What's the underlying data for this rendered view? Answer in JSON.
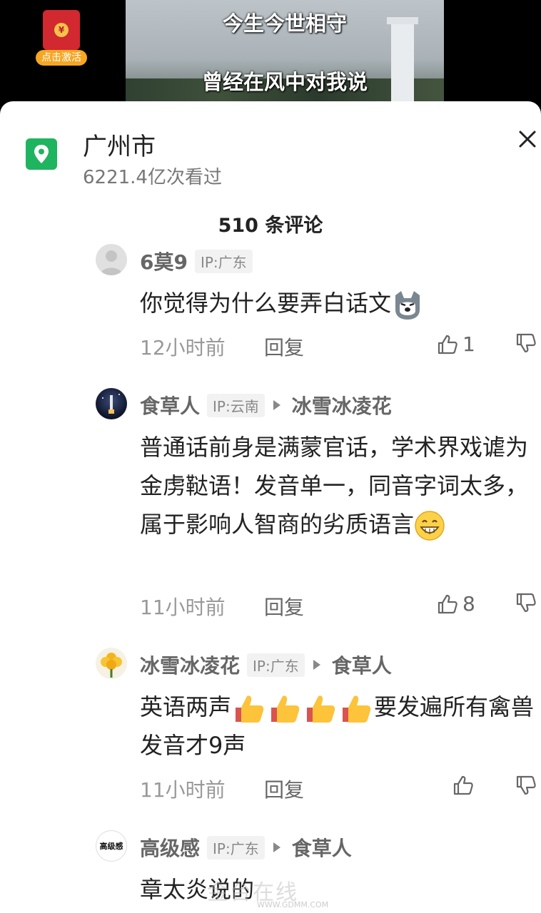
{
  "video": {
    "line1": "今生今世相守",
    "line2": "曾经在风中对我说",
    "red_packet_label": "点击激活"
  },
  "location": {
    "title": "广州市",
    "views": "6221.4亿次看过"
  },
  "comment_count": "510 条评论",
  "comments": [
    {
      "author": "6莫9",
      "ip": "IP:广东",
      "reply_to": "",
      "text": "你觉得为什么要弄白话文",
      "time": "12小时前",
      "reply_label": "回复",
      "likes": "1"
    },
    {
      "author": "食草人",
      "ip": "IP:云南",
      "reply_to": "冰雪冰凌花",
      "text": "普通话前身是满蒙官话，学术界戏谑为金虏鞑语！发音单一，同音字词太多，属于影响人智商的劣质语言",
      "time": "11小时前",
      "reply_label": "回复",
      "likes": "8"
    },
    {
      "author": "冰雪冰凌花",
      "ip": "IP:广东",
      "reply_to": "食草人",
      "text_a": "英语两声",
      "text_b": "要发遍所有禽兽发音才9声",
      "time": "11小时前",
      "reply_label": "回复",
      "likes": ""
    },
    {
      "author": "高级感",
      "ip": "IP:广东",
      "reply_to": "食草人",
      "text": "章太炎说的",
      "avatar_text": "高级感"
    }
  ],
  "watermark": "金台在线",
  "watermark_url": "WWW.GDMM.COM",
  "colors": {
    "location_icon": "#1fb45f",
    "text_primary": "#222222",
    "text_secondary": "#777777"
  }
}
